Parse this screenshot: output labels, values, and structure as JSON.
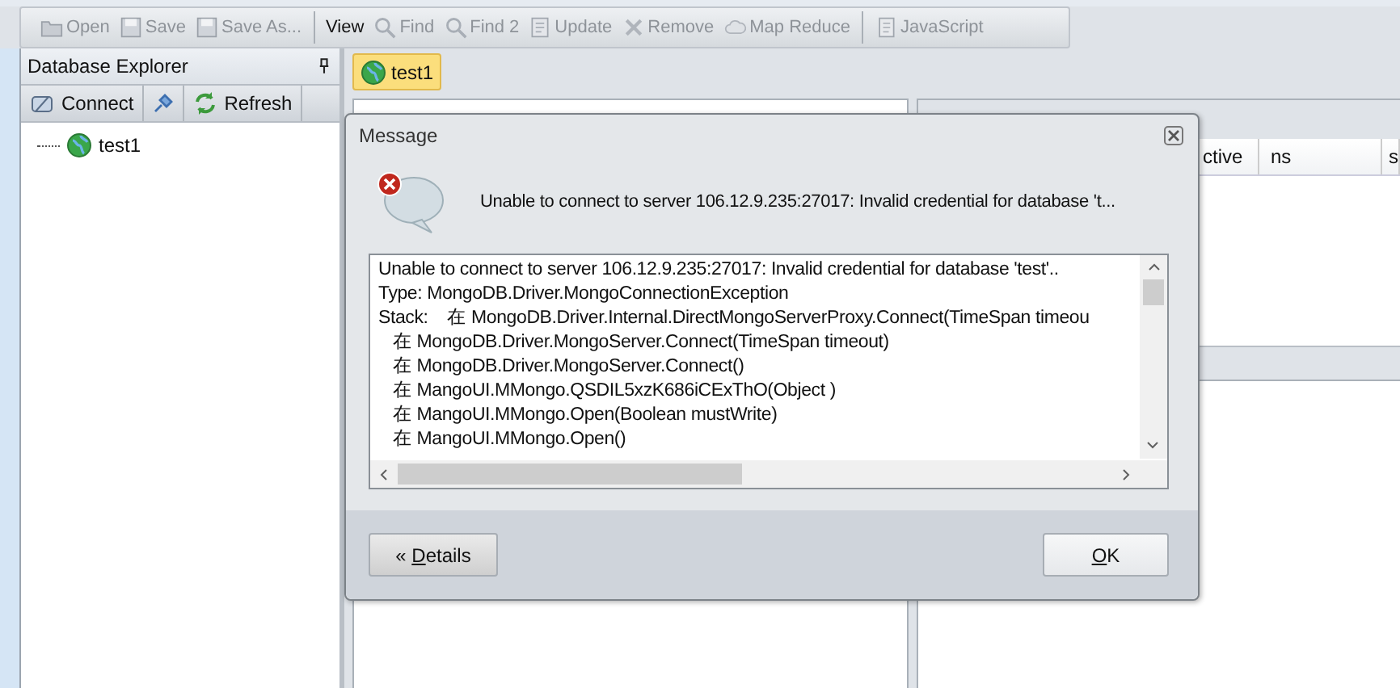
{
  "toolbar": {
    "items": [
      {
        "kind": "button",
        "label": "Open",
        "disabled": true
      },
      {
        "kind": "button",
        "label": "Save",
        "disabled": true
      },
      {
        "kind": "button",
        "label": "Save As...",
        "disabled": true
      },
      {
        "kind": "separator"
      },
      {
        "kind": "button",
        "label": "View",
        "disabled": false
      },
      {
        "kind": "button",
        "label": "Find",
        "disabled": true
      },
      {
        "kind": "button",
        "label": "Find 2",
        "disabled": true
      },
      {
        "kind": "button",
        "label": "Update",
        "disabled": true
      },
      {
        "kind": "button",
        "label": "Remove",
        "disabled": true
      },
      {
        "kind": "button",
        "label": "Map Reduce",
        "disabled": true
      },
      {
        "kind": "separator"
      },
      {
        "kind": "button",
        "label": "JavaScript",
        "disabled": true
      }
    ]
  },
  "explorer": {
    "title": "Database Explorer",
    "buttons": [
      {
        "label": "Connect"
      },
      {
        "kind": "icon"
      },
      {
        "label": "Refresh"
      }
    ],
    "tree": [
      {
        "label": "test1"
      }
    ]
  },
  "tabs": [
    {
      "label": "test1",
      "selected": true
    }
  ],
  "grid": {
    "columns": [
      "ctive",
      "ns",
      "s"
    ]
  },
  "dialog": {
    "title": "Message",
    "message": "Unable to connect to server 106.12.9.235:27017: Invalid credential for database 't...",
    "details": [
      "Unable to connect to server 106.12.9.235:27017: Invalid credential for database 'test'..",
      "Type: MongoDB.Driver.MongoConnectionException",
      "Stack:    在 MongoDB.Driver.Internal.DirectMongoServerProxy.Connect(TimeSpan timeou",
      "   在 MongoDB.Driver.MongoServer.Connect(TimeSpan timeout)",
      "   在 MongoDB.Driver.MongoServer.Connect()",
      "   在 MangoUI.MMongo.QSDIL5xzK686iCExThO(Object )",
      "   在 MangoUI.MMongo.Open(Boolean mustWrite)",
      "   在 MangoUI.MMongo.Open()"
    ],
    "buttons": [
      {
        "kind": "details",
        "prefix": "« ",
        "mnemonic": "D",
        "rest": "etails"
      },
      {
        "kind": "ok",
        "mnemonic": "O",
        "rest": "K"
      }
    ]
  }
}
